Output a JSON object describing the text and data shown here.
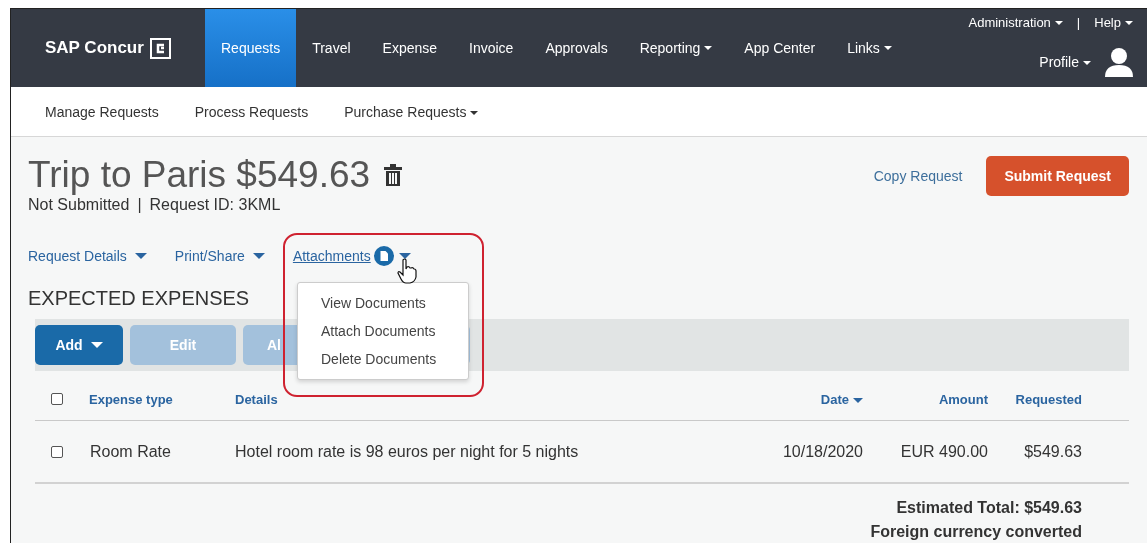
{
  "top_nav": {
    "logo": "SAP Concur",
    "tabs": [
      {
        "label": "Requests",
        "selected": true,
        "dropdown": false
      },
      {
        "label": "Travel",
        "selected": false,
        "dropdown": false
      },
      {
        "label": "Expense",
        "selected": false,
        "dropdown": false
      },
      {
        "label": "Invoice",
        "selected": false,
        "dropdown": false
      },
      {
        "label": "Approvals",
        "selected": false,
        "dropdown": false
      },
      {
        "label": "Reporting",
        "selected": false,
        "dropdown": true
      },
      {
        "label": "App Center",
        "selected": false,
        "dropdown": false
      },
      {
        "label": "Links",
        "selected": false,
        "dropdown": true
      }
    ],
    "utility_links": [
      {
        "label": "Administration",
        "dropdown": true
      },
      {
        "label": "Help",
        "dropdown": true
      }
    ],
    "separator": "|",
    "profile": "Profile"
  },
  "sub_nav": [
    {
      "label": "Manage Requests",
      "dropdown": false
    },
    {
      "label": "Process Requests",
      "dropdown": false
    },
    {
      "label": "Purchase Requests",
      "dropdown": true
    }
  ],
  "request": {
    "title": "Trip to Paris $549.63",
    "status": "Not Submitted",
    "separator": "|",
    "request_id": "Request ID: 3KML",
    "copy_link": "Copy Request",
    "submit_button": "Submit Request"
  },
  "menus": [
    {
      "label": "Request Details",
      "hovered": false,
      "badge": false
    },
    {
      "label": "Print/Share",
      "hovered": false,
      "badge": false
    },
    {
      "label": "Attachments",
      "hovered": true,
      "badge": true
    }
  ],
  "attachments_menu": {
    "open": true,
    "items": [
      {
        "label": "View Documents"
      },
      {
        "label": "Attach Documents"
      },
      {
        "label": "Delete Documents"
      }
    ]
  },
  "section_title": "EXPECTED EXPENSES",
  "toolbar": [
    {
      "label": "Add",
      "dropdown": true,
      "disabled": false
    },
    {
      "label": "Edit",
      "dropdown": false,
      "disabled": true
    },
    {
      "label": "Al",
      "dropdown": false,
      "disabled": true
    }
  ],
  "table": {
    "header_checked": false,
    "columns": [
      {
        "label": "Expense type",
        "sorted": false
      },
      {
        "label": "Details",
        "sorted": false
      },
      {
        "label": "Date",
        "sorted": true
      },
      {
        "label": "Amount",
        "sorted": false
      },
      {
        "label": "Requested",
        "sorted": false
      }
    ],
    "rows": [
      {
        "checked": false,
        "cells": [
          "Room Rate",
          "Hotel room rate is 98 euros per night for 5 nights",
          "10/18/2020",
          "EUR 490.00",
          "$549.63"
        ]
      }
    ]
  },
  "totals": [
    "Estimated Total: $549.63",
    "Foreign currency converted"
  ]
}
